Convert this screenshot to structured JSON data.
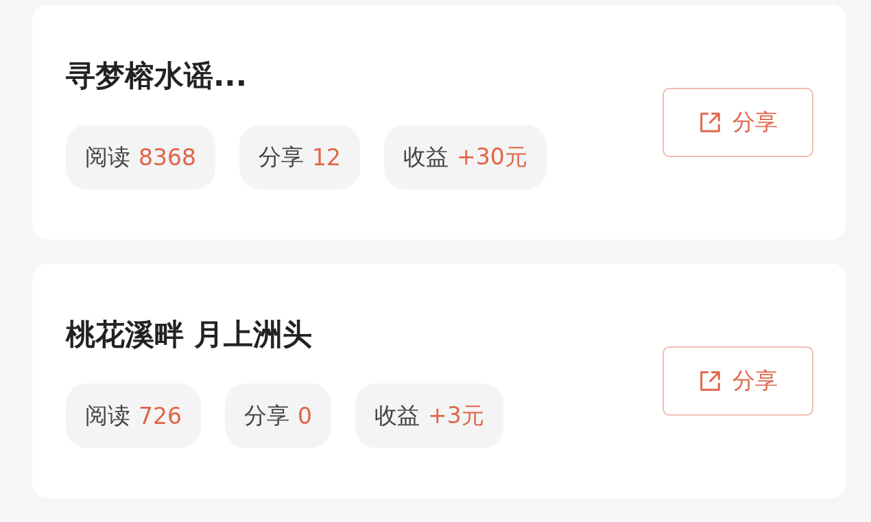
{
  "articles": [
    {
      "title": "寻梦榕水谣...",
      "stats": [
        {
          "label": "阅读",
          "value": "8368"
        },
        {
          "label": "分享",
          "value": "12"
        },
        {
          "label": "收益",
          "value": "+30元"
        }
      ],
      "share_button": "分享"
    },
    {
      "title": "桃花溪畔 月上洲头",
      "stats": [
        {
          "label": "阅读",
          "value": "726"
        },
        {
          "label": "分享",
          "value": "0"
        },
        {
          "label": "收益",
          "value": "+3元"
        }
      ],
      "share_button": "分享"
    }
  ]
}
